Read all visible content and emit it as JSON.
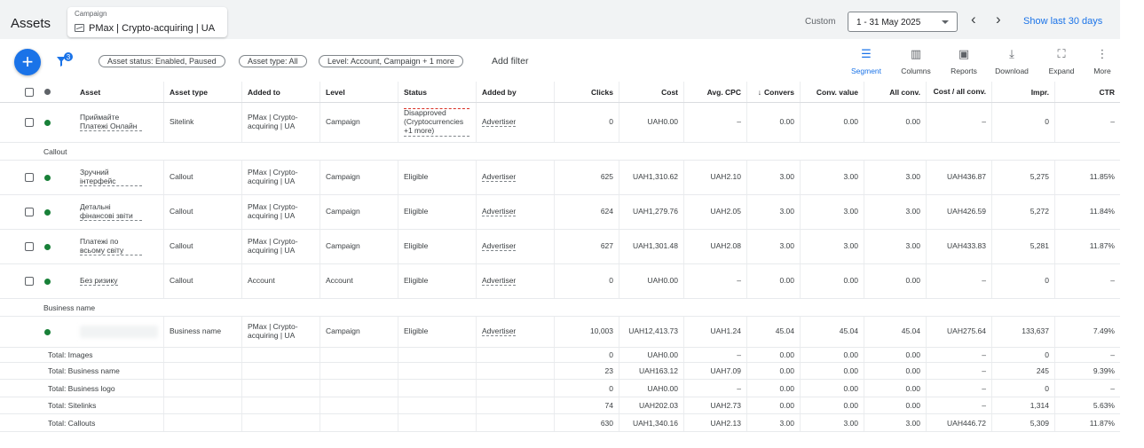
{
  "header": {
    "title": "Assets",
    "campaign_caption": "Campaign",
    "campaign_name": "PMax | Crypto-acquiring | UA",
    "date_label": "Custom",
    "date_range": "1 - 31 May 2025",
    "show_last": "Show last 30 days",
    "prev_icon": "chevron-left-icon",
    "next_icon": "chevron-right-icon"
  },
  "toolbar": {
    "filter_badge": "3",
    "chips": [
      "Asset status: Enabled, Paused",
      "Asset type: All",
      "Level: Account, Campaign + 1 more"
    ],
    "add_filter": "Add filter",
    "buttons": [
      {
        "label": "Segment",
        "icon": "segment-icon",
        "active": true
      },
      {
        "label": "Columns",
        "icon": "columns-icon",
        "active": false
      },
      {
        "label": "Reports",
        "icon": "reports-icon",
        "active": false
      },
      {
        "label": "Download",
        "icon": "download-icon",
        "active": false
      },
      {
        "label": "Expand",
        "icon": "expand-icon",
        "active": false
      },
      {
        "label": "More",
        "icon": "more-vert-icon",
        "active": false
      }
    ]
  },
  "table": {
    "columns": [
      "Asset",
      "Asset type",
      "Added to",
      "Level",
      "Status",
      "Added by",
      "Clicks",
      "Cost",
      "Avg. CPC",
      "Convers",
      "Conv. value",
      "All conv.",
      "Cost / all conv.",
      "Impr.",
      "CTR"
    ],
    "rows": [
      {
        "kind": "data",
        "asset": "Приймайте Платежі Онлайн",
        "type": "Sitelink",
        "added_to": "PMax | Crypto-acquiring | UA",
        "level": "Campaign",
        "status": "Disapproved (Cryptocurrencies +1 more)",
        "added_by": "Advertiser",
        "clicks": "0",
        "cost": "UAH0.00",
        "avg_cpc": "–",
        "conv": "0.00",
        "conv_value": "0.00",
        "all_conv": "0.00",
        "cost_all_conv": "–",
        "impr": "0",
        "ctr": "–"
      },
      {
        "kind": "section",
        "label": "Callout"
      },
      {
        "kind": "data",
        "asset": "Зручний інтерфейс",
        "type": "Callout",
        "added_to": "PMax | Crypto-acquiring | UA",
        "level": "Campaign",
        "status": "Eligible",
        "added_by": "Advertiser",
        "clicks": "625",
        "cost": "UAH1,310.62",
        "avg_cpc": "UAH2.10",
        "conv": "3.00",
        "conv_value": "3.00",
        "all_conv": "3.00",
        "cost_all_conv": "UAH436.87",
        "impr": "5,275",
        "ctr": "11.85%"
      },
      {
        "kind": "data",
        "asset": "Детальні фінансові звіти",
        "type": "Callout",
        "added_to": "PMax | Crypto-acquiring | UA",
        "level": "Campaign",
        "status": "Eligible",
        "added_by": "Advertiser",
        "clicks": "624",
        "cost": "UAH1,279.76",
        "avg_cpc": "UAH2.05",
        "conv": "3.00",
        "conv_value": "3.00",
        "all_conv": "3.00",
        "cost_all_conv": "UAH426.59",
        "impr": "5,272",
        "ctr": "11.84%"
      },
      {
        "kind": "data",
        "asset": "Платежі по всьому світу",
        "type": "Callout",
        "added_to": "PMax | Crypto-acquiring | UA",
        "level": "Campaign",
        "status": "Eligible",
        "added_by": "Advertiser",
        "clicks": "627",
        "cost": "UAH1,301.48",
        "avg_cpc": "UAH2.08",
        "conv": "3.00",
        "conv_value": "3.00",
        "all_conv": "3.00",
        "cost_all_conv": "UAH433.83",
        "impr": "5,281",
        "ctr": "11.87%"
      },
      {
        "kind": "data",
        "asset": "Без ризику",
        "type": "Callout",
        "added_to": "Account",
        "level": "Account",
        "status": "Eligible",
        "added_by": "Advertiser",
        "clicks": "0",
        "cost": "UAH0.00",
        "avg_cpc": "–",
        "conv": "0.00",
        "conv_value": "0.00",
        "all_conv": "0.00",
        "cost_all_conv": "–",
        "impr": "0",
        "ctr": "–"
      },
      {
        "kind": "section",
        "label": "Business name"
      },
      {
        "kind": "data",
        "asset": "",
        "type": "Business name",
        "added_to": "PMax | Crypto-acquiring | UA",
        "level": "Campaign",
        "status": "Eligible",
        "added_by": "Advertiser",
        "clicks": "10,003",
        "cost": "UAH12,413.73",
        "avg_cpc": "UAH1.24",
        "conv": "45.04",
        "conv_value": "45.04",
        "all_conv": "45.04",
        "cost_all_conv": "UAH275.64",
        "impr": "133,637",
        "ctr": "7.49%"
      },
      {
        "kind": "total",
        "label": "Total: Images",
        "clicks": "0",
        "cost": "UAH0.00",
        "avg_cpc": "–",
        "conv": "0.00",
        "conv_value": "0.00",
        "all_conv": "0.00",
        "cost_all_conv": "–",
        "impr": "0",
        "ctr": "–"
      },
      {
        "kind": "total",
        "label": "Total: Business name",
        "clicks": "23",
        "cost": "UAH163.12",
        "avg_cpc": "UAH7.09",
        "conv": "0.00",
        "conv_value": "0.00",
        "all_conv": "0.00",
        "cost_all_conv": "–",
        "impr": "245",
        "ctr": "9.39%"
      },
      {
        "kind": "total",
        "label": "Total: Business logo",
        "clicks": "0",
        "cost": "UAH0.00",
        "avg_cpc": "–",
        "conv": "0.00",
        "conv_value": "0.00",
        "all_conv": "0.00",
        "cost_all_conv": "–",
        "impr": "0",
        "ctr": "–"
      },
      {
        "kind": "total",
        "label": "Total: Sitelinks",
        "clicks": "74",
        "cost": "UAH202.03",
        "avg_cpc": "UAH2.73",
        "conv": "0.00",
        "conv_value": "0.00",
        "all_conv": "0.00",
        "cost_all_conv": "–",
        "impr": "1,314",
        "ctr": "5.63%"
      },
      {
        "kind": "total",
        "label": "Total: Callouts",
        "clicks": "630",
        "cost": "UAH1,340.16",
        "avg_cpc": "UAH2.13",
        "conv": "3.00",
        "conv_value": "3.00",
        "all_conv": "3.00",
        "cost_all_conv": "UAH446.72",
        "impr": "5,309",
        "ctr": "11.87%"
      }
    ]
  },
  "colors": {
    "accent": "#1a73e8",
    "status_green": "#188038",
    "disapproved": "#d93025"
  }
}
